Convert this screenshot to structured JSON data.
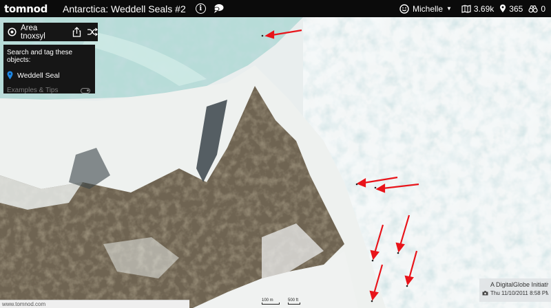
{
  "header": {
    "logo": "tomnod",
    "title": "Antarctica: Weddell Seals #2",
    "info_glyph": "i",
    "user_name": "Michelle",
    "caret": "▼",
    "stats": {
      "map_count": "3.69k",
      "pin_count": "365",
      "score": "0"
    }
  },
  "area_bar": {
    "label": "Area tnoxsyl"
  },
  "task": {
    "heading": "Search and tag these objects:",
    "item": "Weddell Seal",
    "tips": "Examples & Tips"
  },
  "footer": {
    "url": "www.tomnod.com",
    "credit_line1": "A DigitalGlobe Initiative",
    "credit_line2": "Thu 11/10/2011 8:58 PM",
    "scale_a": "100 m",
    "scale_b": "500 ft"
  },
  "colors": {
    "topbar_bg": "#0b0b0b",
    "panel_bg": "#161616",
    "marker_blue": "#1e88e5",
    "arrow_red": "#e8141a"
  },
  "icons": [
    "info-icon",
    "chat-icon",
    "smiley-icon",
    "map-icon",
    "pin-icon",
    "binoculars-icon",
    "location-target-icon",
    "share-icon",
    "shuffle-icon",
    "map-marker-icon",
    "toggle-icon",
    "camera-icon"
  ]
}
